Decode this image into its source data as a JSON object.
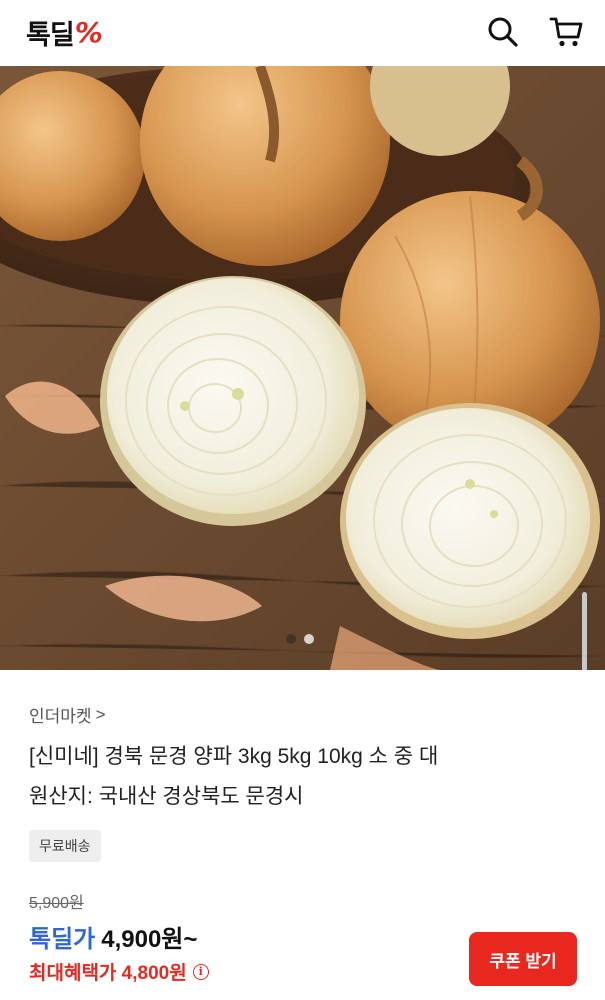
{
  "header": {
    "logo_text": "톡딜",
    "logo_mark": "%",
    "search_icon": "search-icon",
    "cart_icon": "cart-icon"
  },
  "hero": {
    "image_subject": "onions",
    "carousel_total": 2,
    "carousel_active": 2
  },
  "product": {
    "seller": "인더마켓",
    "seller_chevron": ">",
    "title_line1": "[신미네] 경북 문경 양파 3kg 5kg 10kg 소 중 대",
    "title_line2": "원산지: 국내산 경상북도 문경시",
    "badge": "무료배송",
    "original_price": "5,900원",
    "deal_label": "톡딜가",
    "deal_price": "4,900원~",
    "max_benefit_label": "최대혜택가 4,800원",
    "info_glyph": "i",
    "coupon_button": "쿠폰 받기"
  },
  "colors": {
    "accent_red": "#e8281f",
    "deal_blue": "#2f66d6"
  }
}
